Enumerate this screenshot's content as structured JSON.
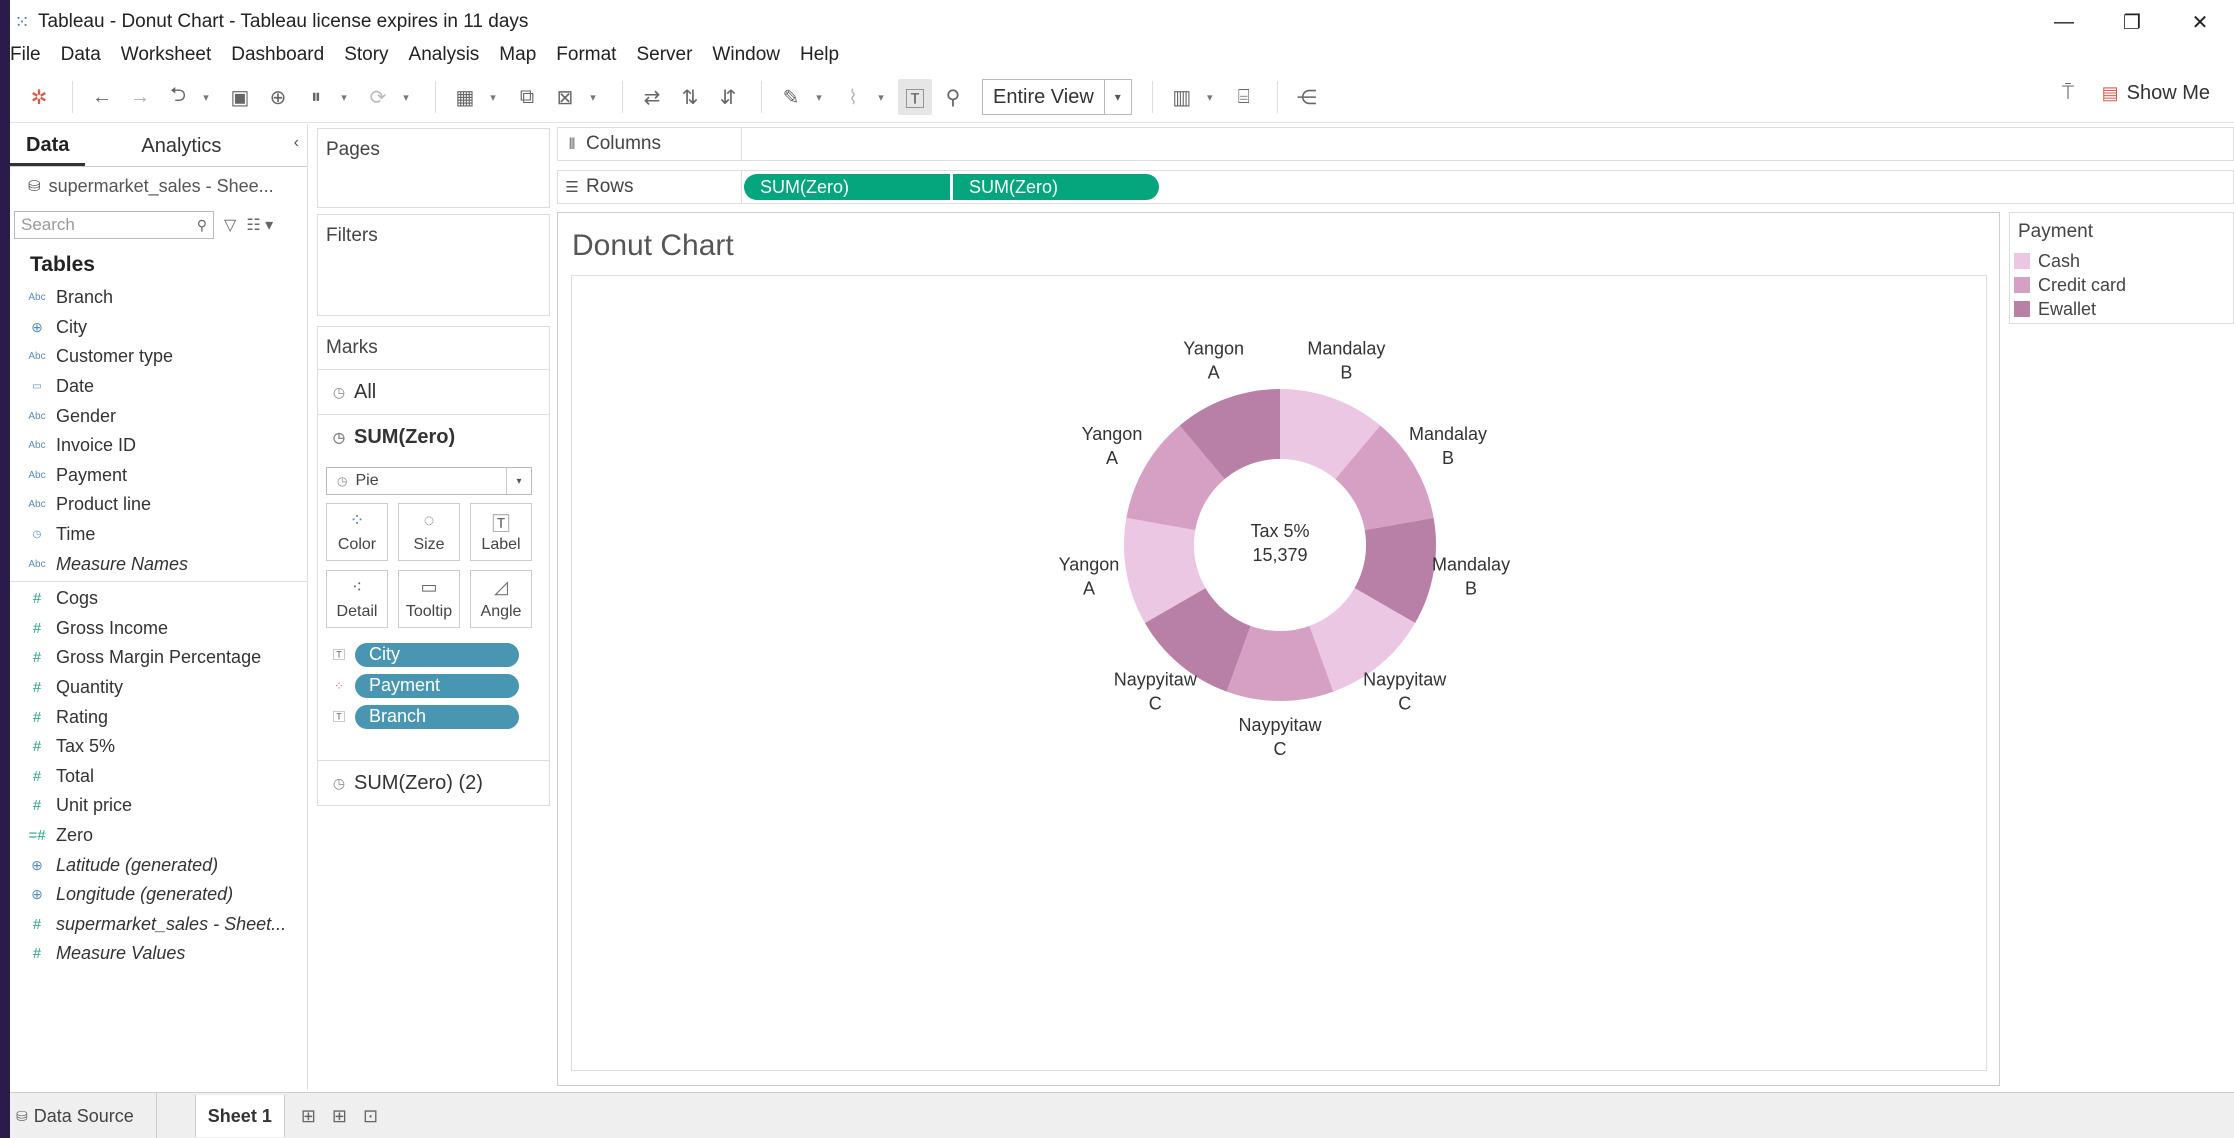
{
  "window": {
    "title": "Tableau - Donut Chart - Tableau license expires in 11 days"
  },
  "menu": [
    "File",
    "Data",
    "Worksheet",
    "Dashboard",
    "Story",
    "Analysis",
    "Map",
    "Format",
    "Server",
    "Window",
    "Help"
  ],
  "toolbar": {
    "fit_value": "Entire View",
    "show_me": "Show Me"
  },
  "datapane": {
    "tab_data": "Data",
    "tab_analytics": "Analytics",
    "source": "supermarket_sales - Shee...",
    "search_placeholder": "Search",
    "tables_header": "Tables",
    "dimensions": [
      {
        "name": "Branch",
        "type": "Abc",
        "italic": false
      },
      {
        "name": "City",
        "type": "geo",
        "italic": false
      },
      {
        "name": "Customer type",
        "type": "Abc",
        "italic": false
      },
      {
        "name": "Date",
        "type": "date",
        "italic": false
      },
      {
        "name": "Gender",
        "type": "Abc",
        "italic": false
      },
      {
        "name": "Invoice ID",
        "type": "Abc",
        "italic": false
      },
      {
        "name": "Payment",
        "type": "Abc",
        "italic": false
      },
      {
        "name": "Product line",
        "type": "Abc",
        "italic": false
      },
      {
        "name": "Time",
        "type": "time",
        "italic": false
      },
      {
        "name": "Measure Names",
        "type": "Abc",
        "italic": true
      }
    ],
    "measures": [
      {
        "name": "Cogs",
        "type": "#",
        "italic": false
      },
      {
        "name": "Gross Income",
        "type": "#",
        "italic": false
      },
      {
        "name": "Gross Margin Percentage",
        "type": "#",
        "italic": false
      },
      {
        "name": "Quantity",
        "type": "#",
        "italic": false
      },
      {
        "name": "Rating",
        "type": "#",
        "italic": false
      },
      {
        "name": "Tax 5%",
        "type": "#",
        "italic": false
      },
      {
        "name": "Total",
        "type": "#",
        "italic": false
      },
      {
        "name": "Unit price",
        "type": "#",
        "italic": false
      },
      {
        "name": "Zero",
        "type": "=#",
        "italic": false
      },
      {
        "name": "Latitude (generated)",
        "type": "geo",
        "italic": true
      },
      {
        "name": "Longitude (generated)",
        "type": "geo",
        "italic": true
      },
      {
        "name": "supermarket_sales - Sheet...",
        "type": "#",
        "italic": true
      },
      {
        "name": "Measure Values",
        "type": "#",
        "italic": true
      }
    ]
  },
  "shelves": {
    "pages": "Pages",
    "filters": "Filters",
    "columns": "Columns",
    "rows": "Rows",
    "row_pills": [
      "SUM(Zero)",
      "SUM(Zero)"
    ]
  },
  "marks": {
    "header": "Marks",
    "all": "All",
    "layer1": "SUM(Zero)",
    "mark_type": "Pie",
    "buttons": [
      "Color",
      "Size",
      "Label",
      "Detail",
      "Tooltip",
      "Angle"
    ],
    "pills": [
      {
        "label": "City",
        "kind": "label"
      },
      {
        "label": "Payment",
        "kind": "color"
      },
      {
        "label": "Branch",
        "kind": "label"
      }
    ],
    "layer2": "SUM(Zero) (2)"
  },
  "viz": {
    "title": "Donut Chart"
  },
  "legend": {
    "title": "Payment",
    "items": [
      {
        "label": "Cash",
        "color": "#ecc7e3"
      },
      {
        "label": "Credit card",
        "color": "#d5a0c4"
      },
      {
        "label": "Ewallet",
        "color": "#b880a6"
      }
    ]
  },
  "chart_data": {
    "type": "pie",
    "center_label": "Tax 5%",
    "center_value": "15,379",
    "segments": [
      {
        "city": "Mandalay",
        "branch": "B",
        "payment": "Cash",
        "value": 1
      },
      {
        "city": "Mandalay",
        "branch": "B",
        "payment": "Credit card",
        "value": 1
      },
      {
        "city": "Mandalay",
        "branch": "B",
        "payment": "Ewallet",
        "value": 1
      },
      {
        "city": "Naypyitaw",
        "branch": "C",
        "payment": "Cash",
        "value": 1
      },
      {
        "city": "Naypyitaw",
        "branch": "C",
        "payment": "Credit card",
        "value": 1
      },
      {
        "city": "Naypyitaw",
        "branch": "C",
        "payment": "Ewallet",
        "value": 1
      },
      {
        "city": "Yangon",
        "branch": "A",
        "payment": "Cash",
        "value": 1
      },
      {
        "city": "Yangon",
        "branch": "A",
        "payment": "Credit card",
        "value": 1
      },
      {
        "city": "Yangon",
        "branch": "A",
        "payment": "Ewallet",
        "value": 1
      }
    ]
  },
  "bottom": {
    "data_source": "Data Source",
    "sheet": "Sheet 1"
  }
}
